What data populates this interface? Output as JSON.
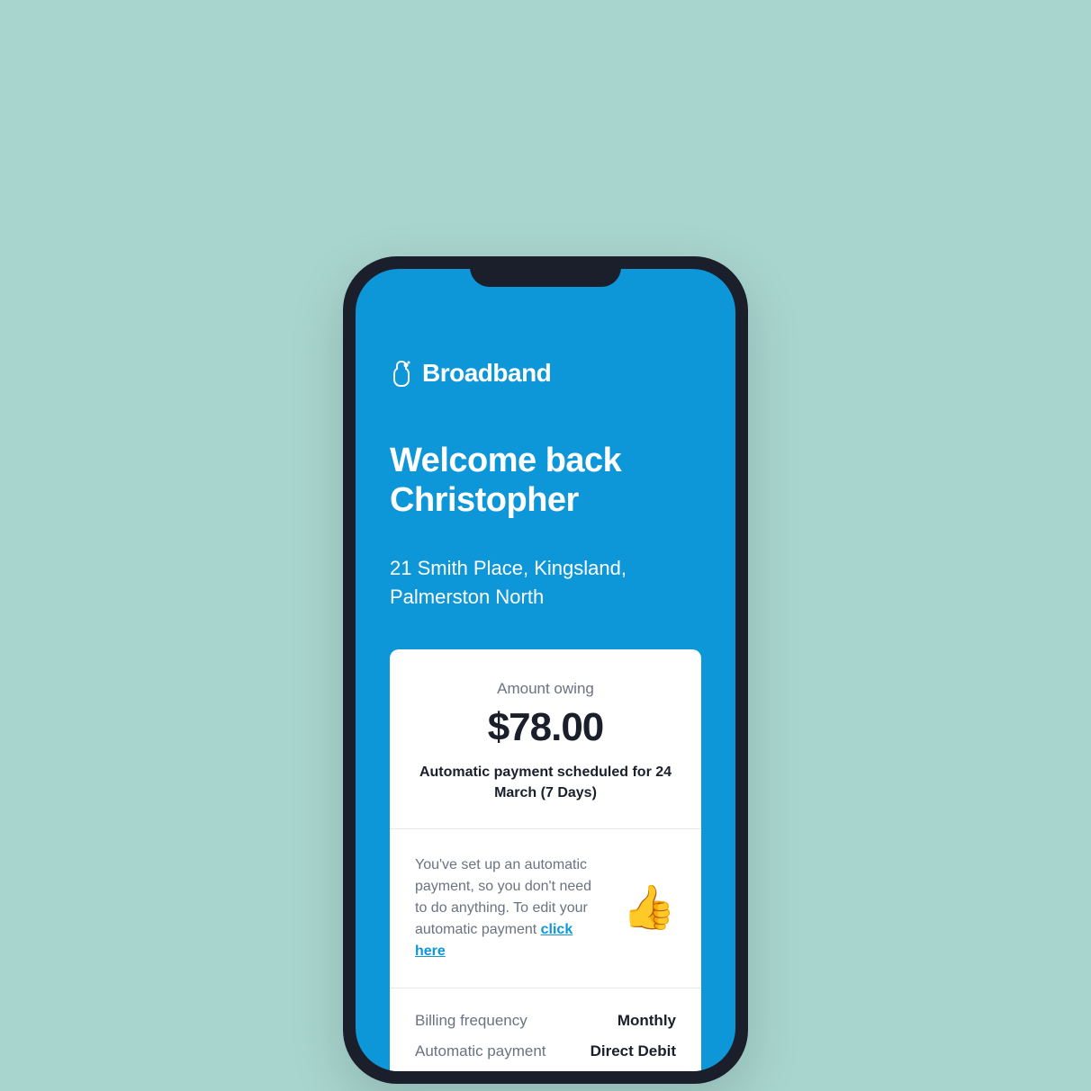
{
  "brand": {
    "name": "Broadband"
  },
  "header": {
    "welcome_line1": "Welcome back",
    "welcome_line2": "Christopher",
    "address_line1": "21 Smith Place, Kingsland,",
    "address_line2": "Palmerston North"
  },
  "amount": {
    "label": "Amount owing",
    "value": "$78.00",
    "schedule": "Automatic payment scheduled for 24 March (7 Days)"
  },
  "message": {
    "text_before": "You've set up an automatic payment, so you don't need to do anything. To edit your automatic payment ",
    "link_text": "click here",
    "emoji": "👍"
  },
  "details": {
    "billing_frequency": {
      "label": "Billing frequency",
      "value": "Monthly"
    },
    "automatic_payment": {
      "label": "Automatic payment",
      "value": "Direct Debit"
    }
  }
}
